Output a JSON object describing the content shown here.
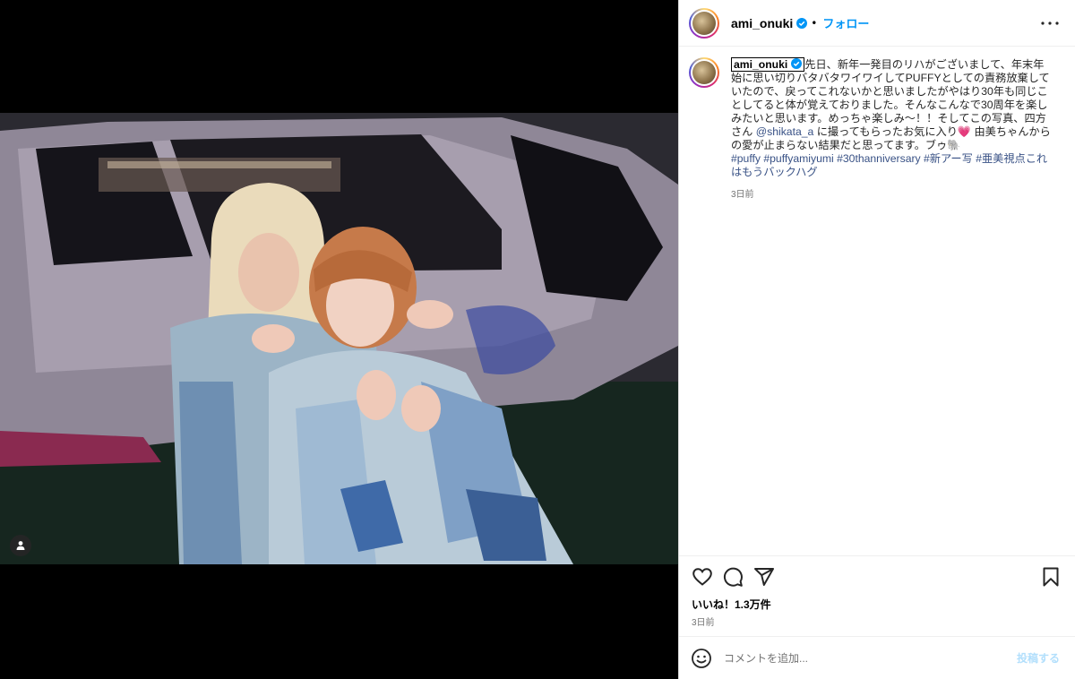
{
  "post": {
    "username": "ami_onuki",
    "verified": true,
    "follow_label": "フォロー",
    "separator": "•"
  },
  "caption": {
    "username": "ami_onuki",
    "text_1": "先日、新年一発目のリハがございまして、年末年始に思い切りバタバタワイワイしてPUFFYとしての責務放棄していたので、戻ってこれないかと思いましたがやはり30年も同じことしてると体が覚えておりました。そんなこんなで30周年を楽しみたいと思います。めっちゃ楽しみ〜！！そしてこの写真、四方さん ",
    "mention": "@shikata_a",
    "text_2": " に撮ってもらったお気に入り💗 由美ちゃんからの愛が止まらない結果だと思ってます。ブゥ🐘",
    "hashtags": [
      "#puffy",
      "#puffyamiyumi",
      "#30thanniversary",
      "#新アー写",
      "#亜美視点これはもうバックハグ"
    ],
    "time": "3日前"
  },
  "engagement": {
    "likes": "いいね！1.3万件",
    "time": "3日前"
  },
  "comment": {
    "placeholder": "コメントを追加...",
    "post_label": "投稿する"
  },
  "icons": {
    "like": "heart-icon",
    "comment": "comment-icon",
    "share": "share-icon",
    "save": "bookmark-icon",
    "emoji": "emoji-icon",
    "user_tag": "user-tag-icon",
    "more": "more-options-icon",
    "verified": "verified-badge-icon"
  },
  "colors": {
    "accent": "#0095f6",
    "link": "#385185",
    "muted": "#737373",
    "verified": "#0095f6"
  }
}
